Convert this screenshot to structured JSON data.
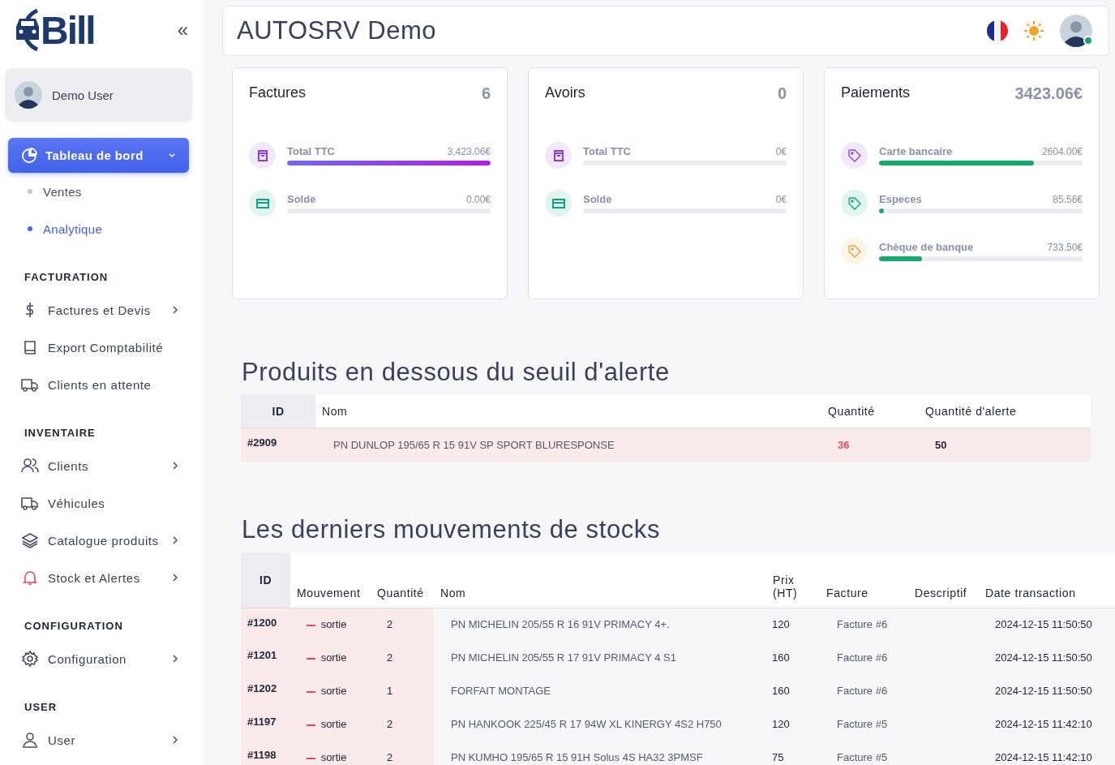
{
  "sidebar": {
    "logo_text": "Bill",
    "collapse_icon": "«",
    "user": {
      "name": "Demo User"
    },
    "dashboard": {
      "label": "Tableau de bord",
      "expanded": true
    },
    "sub_items": [
      {
        "label": "Ventes",
        "selected": false
      },
      {
        "label": "Analytique",
        "selected": true
      }
    ],
    "sections": [
      {
        "title": "FACTURATION",
        "items": [
          {
            "label": "Factures et Devis",
            "has_submenu": true
          },
          {
            "label": "Export Comptabilité",
            "has_submenu": false
          },
          {
            "label": "Clients en attente",
            "has_submenu": false
          }
        ]
      },
      {
        "title": "INVENTAIRE",
        "items": [
          {
            "label": "Clients",
            "has_submenu": true
          },
          {
            "label": "Véhicules",
            "has_submenu": false
          },
          {
            "label": "Catalogue produits",
            "has_submenu": true
          },
          {
            "label": "Stock et Alertes",
            "has_submenu": true
          }
        ]
      },
      {
        "title": "CONFIGURATION",
        "items": [
          {
            "label": "Configuration",
            "has_submenu": true
          }
        ]
      },
      {
        "title": "USER",
        "items": [
          {
            "label": "User",
            "has_submenu": true
          }
        ]
      }
    ]
  },
  "header": {
    "title": "AUTOSRV Demo",
    "user_online": true
  },
  "cards": [
    {
      "title": "Factures",
      "count": "6",
      "metrics": [
        {
          "label": "Total TTC",
          "value": "3,423.06€",
          "level": 1,
          "color": "#8b3fd9"
        },
        {
          "label": "Solde",
          "value": "0.00€",
          "level": 0,
          "color": "#10a37f"
        }
      ]
    },
    {
      "title": "Avoirs",
      "count": "0",
      "metrics": [
        {
          "label": "Total TTC",
          "value": "0€",
          "level": 0,
          "color": "#8b3fd9"
        },
        {
          "label": "Solde",
          "value": "0€",
          "level": 0,
          "color": "#10a37f"
        }
      ]
    },
    {
      "title": "Paiements",
      "count": "3423.06€",
      "metrics": [
        {
          "label": "Carte bancaire",
          "value": "2604.00€",
          "level": 0.76,
          "color": "#8b3fd9"
        },
        {
          "label": "Especes",
          "value": "85.56€",
          "level": 0.025,
          "color": "#10a37f"
        },
        {
          "label": "Chèque de banque",
          "value": "733.50€",
          "level": 0.21,
          "color": "#e8a33d"
        }
      ]
    }
  ],
  "alert_table": {
    "title": "Produits en dessous du seuil d'alerte",
    "columns": [
      "ID",
      "Nom",
      "Quantité",
      "Quantité d'alerte"
    ],
    "rows": [
      {
        "id": "#2909",
        "name": "PN DUNLOP 195/65 R 15 91V SP SPORT BLURESPONSE",
        "quantity": "36",
        "alert_quantity": "50",
        "below_alert": true
      }
    ]
  },
  "stock_table": {
    "title": "Les derniers mouvements de stocks",
    "columns": [
      "ID",
      "Mouvement",
      "Quantité",
      "Nom",
      "Prix (HT)",
      "Facture",
      "Descriptif",
      "Date transaction"
    ],
    "rows": [
      {
        "id": "#1200",
        "movement": "sortie",
        "kind": "out",
        "quantity": "2",
        "name": "PN MICHELIN 205/55 R 16 91V PRIMACY 4+.",
        "price": "120",
        "invoice": "Facture #6",
        "date": "2024-12-15 11:50:50"
      },
      {
        "id": "#1201",
        "movement": "sortie",
        "kind": "out",
        "quantity": "2",
        "name": "PN MICHELIN 205/55 R 17 91V PRIMACY 4 S1",
        "price": "160",
        "invoice": "Facture #6",
        "date": "2024-12-15 11:50:50"
      },
      {
        "id": "#1202",
        "movement": "sortie",
        "kind": "out",
        "quantity": "1",
        "name": "FORFAIT MONTAGE",
        "price": "160",
        "invoice": "Facture #6",
        "date": "2024-12-15 11:50:50"
      },
      {
        "id": "#1197",
        "movement": "sortie",
        "kind": "out",
        "quantity": "2",
        "name": "PN HANKOOK 225/45 R 17 94W XL KINERGY 4S2 H750",
        "price": "120",
        "invoice": "Facture #5",
        "date": "2024-12-15 11:42:10"
      },
      {
        "id": "#1198",
        "movement": "sortie",
        "kind": "out",
        "quantity": "2",
        "name": "PN KUMHO 195/65 R 15 91H Solus 4S HA32 3PMSF",
        "price": "75",
        "invoice": "Facture #5",
        "date": "2024-12-15 11:42:10"
      }
    ]
  }
}
